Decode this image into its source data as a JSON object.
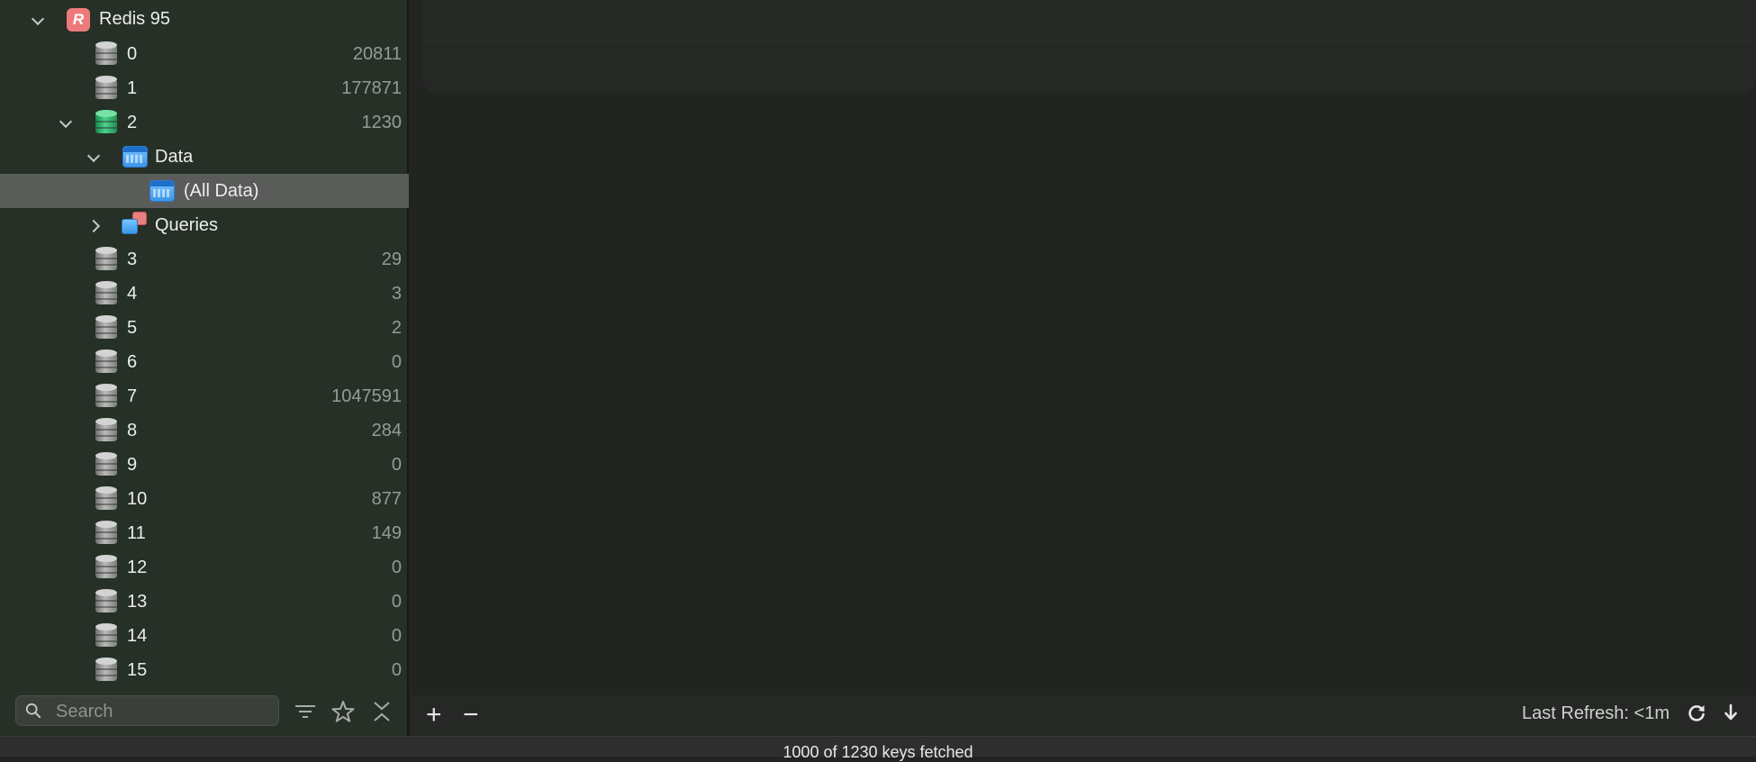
{
  "sidebar": {
    "connection": {
      "name": "Redis 95",
      "icon": "redis-icon"
    },
    "databases": [
      {
        "label": "0",
        "count": "20811"
      },
      {
        "label": "1",
        "count": "177871"
      },
      {
        "label": "2",
        "count": "1230",
        "expanded": true,
        "color": "green"
      },
      {
        "label": "3",
        "count": "29"
      },
      {
        "label": "4",
        "count": "3"
      },
      {
        "label": "5",
        "count": "2"
      },
      {
        "label": "6",
        "count": "0"
      },
      {
        "label": "7",
        "count": "1047591"
      },
      {
        "label": "8",
        "count": "284"
      },
      {
        "label": "9",
        "count": "0"
      },
      {
        "label": "10",
        "count": "877"
      },
      {
        "label": "11",
        "count": "149"
      },
      {
        "label": "12",
        "count": "0"
      },
      {
        "label": "13",
        "count": "0"
      },
      {
        "label": "14",
        "count": "0"
      },
      {
        "label": "15",
        "count": "0"
      }
    ],
    "data_folder": {
      "label": "Data"
    },
    "all_data": {
      "label": "(All Data)"
    },
    "queries": {
      "label": "Queries"
    },
    "search": {
      "placeholder": "Search"
    }
  },
  "toolbar": {
    "add_label": "+",
    "remove_label": "−",
    "last_refresh": "Last Refresh: <1m"
  },
  "status": {
    "text": "1000 of 1230 keys fetched"
  },
  "colors": {
    "accent_green": "#3fc07a",
    "redis_red": "#ed7a7a",
    "selection": "#5a5c5a"
  }
}
